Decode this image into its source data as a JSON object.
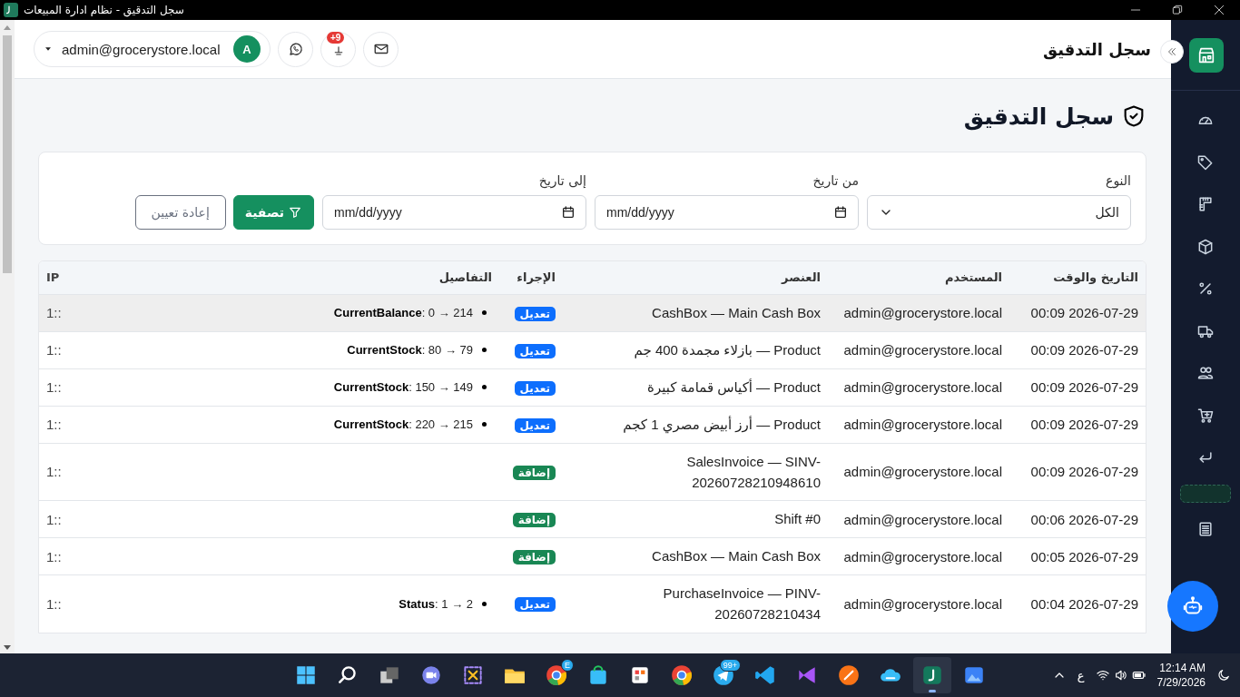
{
  "window": {
    "title": "سجل التدقيق - نظام ادارة المبيعات"
  },
  "header": {
    "page_title": "سجل التدقيق",
    "user_email": "admin@grocerystore.local",
    "avatar_letter": "A",
    "notification_badge": "+9"
  },
  "heading": "سجل التدقيق",
  "filters": {
    "type": {
      "label": "النوع",
      "value": "الكل"
    },
    "from_date": {
      "label": "من تاريخ",
      "placeholder": "mm/dd/yyyy"
    },
    "to_date": {
      "label": "إلى تاريخ",
      "placeholder": "mm/dd/yyyy"
    },
    "buttons": [
      {
        "label": "تصفية",
        "kind": "primary"
      },
      {
        "label": "إعادة تعيين",
        "kind": "outline"
      }
    ]
  },
  "table": {
    "columns": [
      "التاريخ والوقت",
      "المستخدم",
      "العنصر",
      "الإجراء",
      "التفاصيل",
      "IP"
    ],
    "rows": [
      {
        "selected": true,
        "datetime": "00:09 2026-07-29",
        "user": "admin@grocerystore.local",
        "item": "CashBox — Main Cash Box",
        "action": {
          "label": "تعديل",
          "kind": "edit"
        },
        "details": [
          "**CurrentBalance**: 0 → 214"
        ],
        "ip": "1::"
      },
      {
        "selected": false,
        "datetime": "00:09 2026-07-29",
        "user": "admin@grocerystore.local",
        "item": "Product — بازلاء مجمدة 400 جم",
        "action": {
          "label": "تعديل",
          "kind": "edit"
        },
        "details": [
          "**CurrentStock**: 80 → 79"
        ],
        "ip": "1::"
      },
      {
        "selected": false,
        "datetime": "00:09 2026-07-29",
        "user": "admin@grocerystore.local",
        "item": "Product — أكياس قمامة كبيرة",
        "action": {
          "label": "تعديل",
          "kind": "edit"
        },
        "details": [
          "**CurrentStock**: 150 → 149"
        ],
        "ip": "1::"
      },
      {
        "selected": false,
        "datetime": "00:09 2026-07-29",
        "user": "admin@grocerystore.local",
        "item": "Product — أرز أبيض مصري 1 كجم",
        "action": {
          "label": "تعديل",
          "kind": "edit"
        },
        "details": [
          "**CurrentStock**: 220 → 215"
        ],
        "ip": "1::"
      },
      {
        "selected": false,
        "datetime": "00:09 2026-07-29",
        "user": "admin@grocerystore.local",
        "item": "SalesInvoice — SINV-20260728210948610",
        "action": {
          "label": "إضافة",
          "kind": "add"
        },
        "ip": "1::"
      },
      {
        "selected": false,
        "datetime": "00:06 2026-07-29",
        "user": "admin@grocerystore.local",
        "item": "Shift #0",
        "action": {
          "label": "إضافة",
          "kind": "add"
        },
        "ip": "1::"
      },
      {
        "selected": false,
        "datetime": "00:05 2026-07-29",
        "user": "admin@grocerystore.local",
        "item": "CashBox — Main Cash Box",
        "action": {
          "label": "إضافة",
          "kind": "add"
        },
        "ip": "1::"
      },
      {
        "selected": false,
        "datetime": "00:04 2026-07-29",
        "user": "admin@grocerystore.local",
        "item": "PurchaseInvoice — PINV-20260728210434",
        "action": {
          "label": "تعديل",
          "kind": "edit"
        },
        "details": [
          "**Status**: 1 → 2"
        ],
        "ip": "1::"
      }
    ]
  },
  "sidebar": {
    "items": [
      {
        "kind": "gauge",
        "selected": false
      },
      {
        "kind": "tag",
        "selected": false
      },
      {
        "kind": "ruler",
        "selected": false
      },
      {
        "kind": "box",
        "selected": false
      },
      {
        "kind": "percent",
        "selected": false
      },
      {
        "kind": "truck",
        "selected": false
      },
      {
        "kind": "users",
        "selected": false
      },
      {
        "kind": "cart",
        "selected": false
      },
      {
        "kind": "return",
        "selected": false
      },
      {
        "kind": "blank",
        "selected": true
      },
      {
        "kind": "ledger",
        "selected": false
      }
    ]
  },
  "taskbar": {
    "items": [
      {
        "kind": "photos",
        "active": false
      },
      {
        "kind": "app",
        "active": true
      },
      {
        "kind": "cloud",
        "active": false
      },
      {
        "kind": "postman",
        "active": false
      },
      {
        "kind": "studio",
        "active": false
      },
      {
        "kind": "code",
        "active": false
      },
      {
        "kind": "telegram",
        "active": false,
        "badge": "99+"
      },
      {
        "kind": "browser",
        "active": false
      },
      {
        "kind": "office",
        "active": false
      },
      {
        "kind": "store",
        "active": false
      },
      {
        "kind": "browser",
        "active": false,
        "badge": "E"
      },
      {
        "kind": "folder",
        "active": false
      },
      {
        "kind": "snip",
        "active": false
      },
      {
        "kind": "chat",
        "active": false
      },
      {
        "kind": "taskview",
        "active": false
      },
      {
        "kind": "search",
        "active": false
      },
      {
        "kind": "start",
        "active": false
      }
    ],
    "tray": {
      "language": "ع",
      "time": "12:14 AM",
      "date": "7/29/2026"
    }
  }
}
